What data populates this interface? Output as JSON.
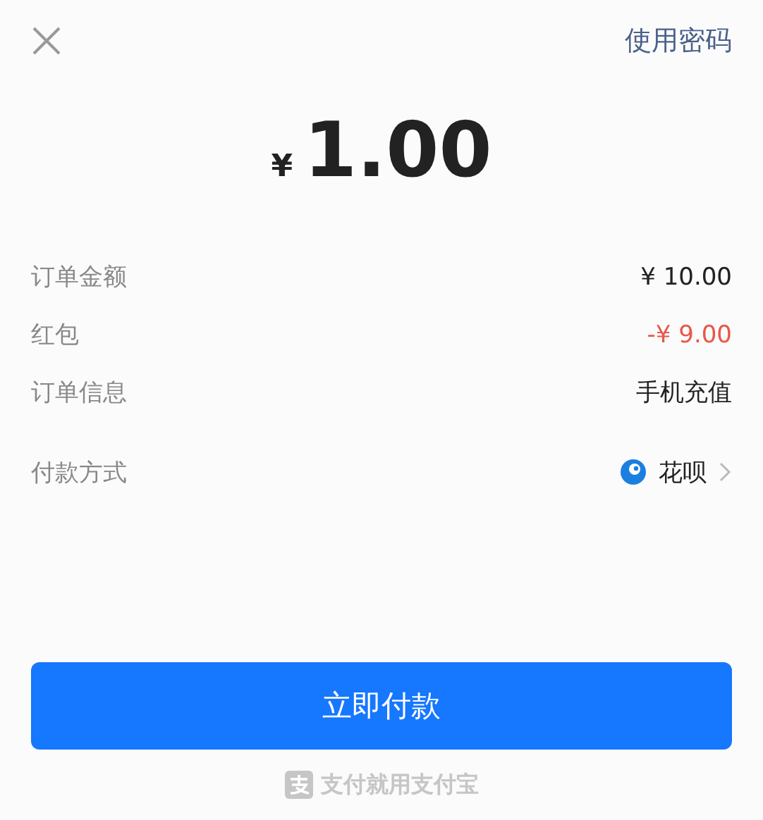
{
  "header": {
    "action": "使用密码"
  },
  "amount": {
    "currency": "¥",
    "value": "1.00"
  },
  "details": [
    {
      "label": "订单金额",
      "value": "¥ 10.00",
      "kind": "normal"
    },
    {
      "label": "红包",
      "value": "-¥ 9.00",
      "kind": "discount"
    },
    {
      "label": "订单信息",
      "value": "手机充值",
      "kind": "normal"
    }
  ],
  "payment_method": {
    "label": "付款方式",
    "value": "花呗"
  },
  "pay_button": "立即付款",
  "footer": "支付就用支付宝"
}
